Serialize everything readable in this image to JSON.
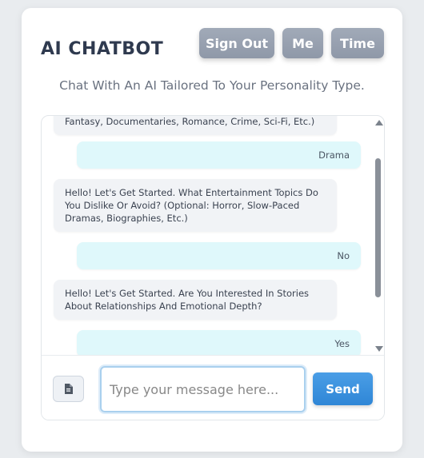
{
  "header": {
    "title": "AI CHATBOT",
    "subtitle": "Chat With An AI Tailored To Your Personality Type.",
    "buttons": {
      "sign_out": "Sign Out",
      "me": "Me",
      "time": "Time"
    }
  },
  "messages": [
    {
      "role": "bot",
      "text": "Fantasy, Documentaries, Romance, Crime, Sci-Fi, Etc.)"
    },
    {
      "role": "user",
      "text": "Drama"
    },
    {
      "role": "bot",
      "text": "Hello! Let's Get Started. What Entertainment Topics Do You Dislike Or Avoid? (Optional: Horror, Slow-Paced Dramas, Biographies, Etc.)"
    },
    {
      "role": "user",
      "text": "No"
    },
    {
      "role": "bot",
      "text": "Hello! Let's Get Started. Are You Interested In Stories About Relationships And Emotional Depth?"
    },
    {
      "role": "user",
      "text": "Yes"
    }
  ],
  "composer": {
    "placeholder": "Type your message here...",
    "value": "",
    "send_label": "Send",
    "attach_icon": "file-icon"
  },
  "colors": {
    "header_button": "#98a1b1",
    "send_button": "#3a92de",
    "user_bubble": "#dff8fb",
    "bot_bubble": "#f1f3f6"
  }
}
